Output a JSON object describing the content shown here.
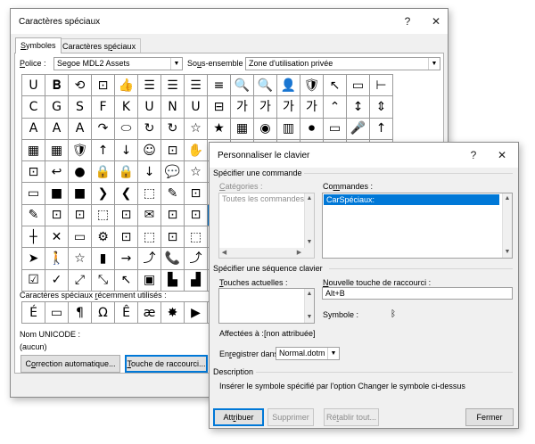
{
  "main_dialog": {
    "title": "Caractères spéciaux",
    "help": "?",
    "close": "✕",
    "tabs": [
      {
        "prefix": "",
        "accel": "S",
        "suffix": "ymboles"
      },
      {
        "prefix": "Caractères s",
        "accel": "p",
        "suffix": "éciaux"
      }
    ],
    "font_label": {
      "prefix": "",
      "accel": "P",
      "suffix": "olice :"
    },
    "font_value": "Segoe MDL2 Assets",
    "subset_label": {
      "prefix": "So",
      "accel": "u",
      "suffix": "s-ensemble :"
    },
    "subset_value": "Zone d'utilisation privée",
    "symbols": [
      "U",
      "𝐁",
      "⟲",
      "⊡",
      "👍",
      "☰",
      "☰",
      "☰",
      "≡",
      "🔍",
      "🔍",
      "👤",
      "🛡",
      "↖",
      "▭",
      "⊢",
      "↦",
      "✉",
      "C",
      "G",
      "S",
      "F",
      "K",
      "U",
      "N",
      "U",
      "⊟",
      "가",
      "가",
      "가",
      "가",
      "⌃",
      "↕",
      "⇕",
      "☐",
      "✉",
      "A",
      "A",
      "A",
      "↷",
      "⬭",
      "↻",
      "↻",
      "☆",
      "★",
      "▦",
      "◉",
      "▥",
      "⏺",
      "▭",
      "🎤",
      "↑",
      "↖",
      "↕",
      "▦",
      "▦",
      "🛡",
      "↑",
      "↓",
      "☺",
      "⊡",
      "✋",
      "⊟",
      "☰",
      "⚠",
      "⤢",
      "⊞",
      "⊠",
      "⊡",
      "⊟",
      "⊠",
      "⊟",
      "⊡",
      "↩",
      "●",
      "🔒",
      "🔒",
      "↓",
      "💬",
      "☆",
      "⬭",
      "⬭",
      "🔒",
      "⊡",
      "↻",
      "⊡",
      "🔒",
      "⊡",
      "⊡",
      "⊡",
      "▭",
      "■",
      "■",
      "❯",
      "❮",
      "⬚",
      "✎",
      "⊡",
      "⊡",
      "⊠",
      "⊡",
      "⊡",
      "⊡",
      "⊡",
      "⊡",
      "⊡",
      "⊡",
      "⊡",
      "✎",
      "⊡",
      "⊡",
      "⬚",
      "⊡",
      "✉",
      "⊡",
      "⊡",
      "ᛒ",
      "⊡",
      "((·))",
      "⊡",
      "⊡",
      "⊡",
      "⊡",
      "⊡",
      "⊡",
      "⊡",
      "┼",
      "✕",
      "▭",
      "⚙",
      "⊡",
      "⬚",
      "⊡",
      "⬚",
      "⊡",
      "⊡",
      "⊡",
      "⊡",
      "⊡",
      "⊡",
      "⊡",
      "⊡",
      "⊡",
      "⊡",
      "➤",
      "🚶",
      "☆",
      "▮",
      "→",
      "⤴",
      "📞",
      "⤴",
      "⤴",
      "⊡",
      "⊡",
      "⊡",
      "⊡",
      "⊡",
      "⊡",
      "⊡",
      "⊡",
      "⊡",
      "☑",
      "✓",
      "⤢",
      "⤡",
      "↖",
      "▣",
      "▙",
      "▟",
      "▀",
      "⊡",
      "⊡",
      "⊡",
      "⊡",
      "⊡",
      "⊡",
      "⊡",
      "⊡",
      "⊡"
    ],
    "selected_symbol": "ᛒ",
    "recent_label": {
      "prefix": "Caractères spéciaux ",
      "accel": "r",
      "suffix": "écemment utilisés :"
    },
    "recent": [
      "É",
      "▭",
      "¶",
      "Ω",
      "Ê",
      "æ",
      "✸",
      "▶",
      "•",
      "▼"
    ],
    "unicode_label": "Nom UNICODE :",
    "unicode_value": "(aucun)",
    "autocorrect_button": {
      "prefix": "C",
      "accel": "o",
      "suffix": "rrection automatique..."
    },
    "shortcut_button": {
      "prefix": "",
      "accel": "T",
      "suffix": "ouche de raccourci..."
    }
  },
  "keyboard_dialog": {
    "title": "Personnaliser le clavier",
    "help": "?",
    "close": "✕",
    "command_section": "Spécifier une commande",
    "categories_label": {
      "prefix": "",
      "accel": "C",
      "suffix": "atégories :"
    },
    "categories": [
      "Toutes les commandes"
    ],
    "commands_label": {
      "prefix": "Co",
      "accel": "m",
      "suffix": "mandes :"
    },
    "commands": [
      "CarSpéciaux:"
    ],
    "key_section": "Spécifier une séquence clavier",
    "current_keys_label": {
      "prefix": "",
      "accel": "T",
      "suffix": "ouches actuelles :"
    },
    "new_key_label": {
      "prefix": "",
      "accel": "N",
      "suffix": "ouvelle touche de raccourci :"
    },
    "new_key_value": "Alt+B",
    "symbol_label": "Symbole :",
    "symbol_value": "ᛒ",
    "assigned_label": "Affectées à :",
    "assigned_value": "[non attribuée]",
    "save_label": {
      "prefix": "En",
      "accel": "r",
      "suffix": "egistrer dans :"
    },
    "save_value": "Normal.dotm",
    "description_section": "Description",
    "description_text": "Insérer le symbole spécifié par l'option Changer le symbole ci-dessus",
    "assign_button": {
      "prefix": "Att",
      "accel": "r",
      "suffix": "ibuer"
    },
    "remove_button": "Supprimer",
    "reset_button": {
      "prefix": "Ré",
      "accel": "t",
      "suffix": "ablir tout..."
    },
    "close_button": "Fermer"
  },
  "colors": {
    "accent": "#0078d7",
    "dialog_bg": "#f0f0f0",
    "disabled_text": "#8d8d8d"
  }
}
